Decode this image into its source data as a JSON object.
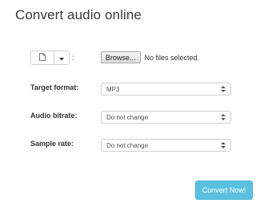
{
  "page": {
    "title": "Convert audio online"
  },
  "source": {
    "colon": ":",
    "browse_label": "Browse...",
    "file_status": "No files selected."
  },
  "form": {
    "target_format": {
      "label": "Target format:",
      "value": "MP3"
    },
    "audio_bitrate": {
      "label": "Audio bitrate:",
      "value": "Do not change"
    },
    "sample_rate": {
      "label": "Sample rate:",
      "value": "Do not change"
    }
  },
  "actions": {
    "convert_label": "Convert Now!"
  },
  "colors": {
    "accent": "#5bc0de",
    "border": "#cfcfcf",
    "text": "#333333"
  },
  "icons": {
    "file": "file-icon",
    "dropdown": "caret-down-icon",
    "select_arrows": "up-down-arrows-icon"
  }
}
